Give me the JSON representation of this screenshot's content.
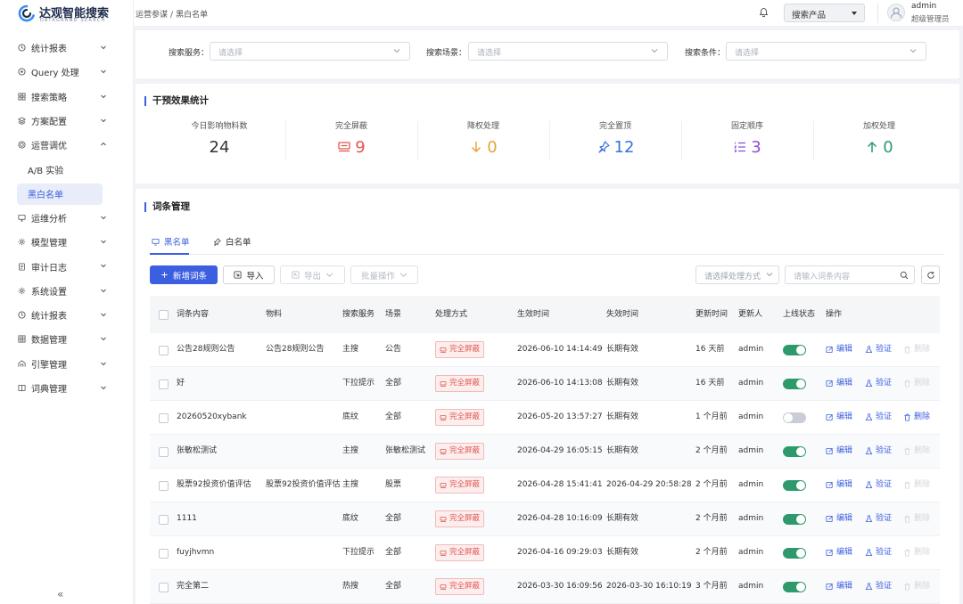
{
  "brand": {
    "name_cn": "达观智能搜索",
    "name_en": "DATAGRAND SEARCH"
  },
  "breadcrumb": [
    "运营参谋",
    "黑白名单"
  ],
  "breadcrumb_sep": "/",
  "topbar": {
    "product_select": "搜索产品",
    "user_name": "admin",
    "user_role": "超级管理员"
  },
  "sidebar": {
    "items": [
      {
        "label": "统计报表",
        "icon": "clock-icon"
      },
      {
        "label": "Query 处理",
        "icon": "query-icon"
      },
      {
        "label": "搜索策略",
        "icon": "grid-icon"
      },
      {
        "label": "方案配置",
        "icon": "layers-icon"
      },
      {
        "label": "运营调优",
        "icon": "target-icon",
        "expanded": true,
        "children": [
          "A/B 实验",
          "黑白名单"
        ]
      },
      {
        "label": "运维分析",
        "icon": "monitor-icon"
      },
      {
        "label": "模型管理",
        "icon": "gear-icon"
      },
      {
        "label": "审计日志",
        "icon": "file-icon"
      },
      {
        "label": "系统设置",
        "icon": "gear-icon"
      },
      {
        "label": "统计报表",
        "icon": "clock-icon"
      },
      {
        "label": "数据管理",
        "icon": "database-icon"
      },
      {
        "label": "引擎管理",
        "icon": "engine-icon"
      },
      {
        "label": "词典管理",
        "icon": "book-icon"
      }
    ],
    "collapse_glyph": "«"
  },
  "filters": [
    {
      "label": "搜索服务：",
      "placeholder": "请选择"
    },
    {
      "label": "搜索场景：",
      "placeholder": "请选择"
    },
    {
      "label": "搜索条件：",
      "placeholder": "请选择"
    }
  ],
  "stats": {
    "title": "干预效果统计",
    "items": [
      {
        "label": "今日影响物料数",
        "value": "24",
        "icon": "",
        "color": "#333333"
      },
      {
        "label": "完全屏蔽",
        "value": "9",
        "icon": "block-icon",
        "color": "#e0554f"
      },
      {
        "label": "降权处理",
        "value": "0",
        "icon": "arrow-down-icon",
        "color": "#e8a33b"
      },
      {
        "label": "完全置顶",
        "value": "12",
        "icon": "pin-icon",
        "color": "#3b6fe0"
      },
      {
        "label": "固定顺序",
        "value": "3",
        "icon": "list-order-icon",
        "color": "#8a4fd6"
      },
      {
        "label": "加权处理",
        "value": "0",
        "icon": "arrow-up-icon",
        "color": "#2e9a6c"
      }
    ]
  },
  "words": {
    "title": "词条管理",
    "tabs": [
      "黑名单",
      "白名单"
    ],
    "buttons": {
      "add": "新增词条",
      "import": "导入",
      "export": "导出",
      "batch": "批量操作"
    },
    "method_select": "请选择处理方式",
    "search_placeholder": "请输入词条内容",
    "columns": [
      "词条内容",
      "物料",
      "搜索服务",
      "场景",
      "处理方式",
      "生效时间",
      "失效时间",
      "更新时间",
      "更新人",
      "上线状态",
      "操作"
    ],
    "actions": {
      "edit": "编辑",
      "verify": "验证",
      "delete": "删除"
    },
    "rows": [
      {
        "content": "公告28规则公告",
        "material": "公告28规则公告",
        "service": "主搜",
        "scene": "公告",
        "method": "完全屏蔽",
        "start": "2026-06-10 14:14:49",
        "end": "长期有效",
        "updated": "16 天前",
        "user": "admin",
        "online": true
      },
      {
        "content": "好",
        "material": "",
        "service": "下拉提示",
        "scene": "全部",
        "method": "完全屏蔽",
        "start": "2026-06-10 14:13:08",
        "end": "长期有效",
        "updated": "16 天前",
        "user": "admin",
        "online": true
      },
      {
        "content": "20260520xybank",
        "material": "",
        "service": "底纹",
        "scene": "全部",
        "method": "完全屏蔽",
        "start": "2026-05-20 13:57:27",
        "end": "长期有效",
        "updated": "1 个月前",
        "user": "admin",
        "online": false
      },
      {
        "content": "张敏松测试",
        "material": "",
        "service": "主搜",
        "scene": "张敏松测试",
        "method": "完全屏蔽",
        "start": "2026-04-29 16:05:15",
        "end": "长期有效",
        "updated": "2 个月前",
        "user": "admin",
        "online": true
      },
      {
        "content": "股票92投资价值评估",
        "material": "股票92投资价值评估",
        "service": "主搜",
        "scene": "股票",
        "method": "完全屏蔽",
        "start": "2026-04-28 15:41:41",
        "end": "2026-04-29 20:58:28",
        "updated": "2 个月前",
        "user": "admin",
        "online": true
      },
      {
        "content": "1111",
        "material": "",
        "service": "底纹",
        "scene": "全部",
        "method": "完全屏蔽",
        "start": "2026-04-28 10:16:09",
        "end": "长期有效",
        "updated": "2 个月前",
        "user": "admin",
        "online": true
      },
      {
        "content": "fuyjhvmn",
        "material": "",
        "service": "下拉提示",
        "scene": "全部",
        "method": "完全屏蔽",
        "start": "2026-04-16 09:29:03",
        "end": "长期有效",
        "updated": "2 个月前",
        "user": "admin",
        "online": true
      },
      {
        "content": "完全第二",
        "material": "",
        "service": "热搜",
        "scene": "全部",
        "method": "完全屏蔽",
        "start": "2026-03-30 16:09:56",
        "end": "2026-03-30 16:10:19",
        "updated": "3 个月前",
        "user": "admin",
        "online": true
      }
    ]
  }
}
